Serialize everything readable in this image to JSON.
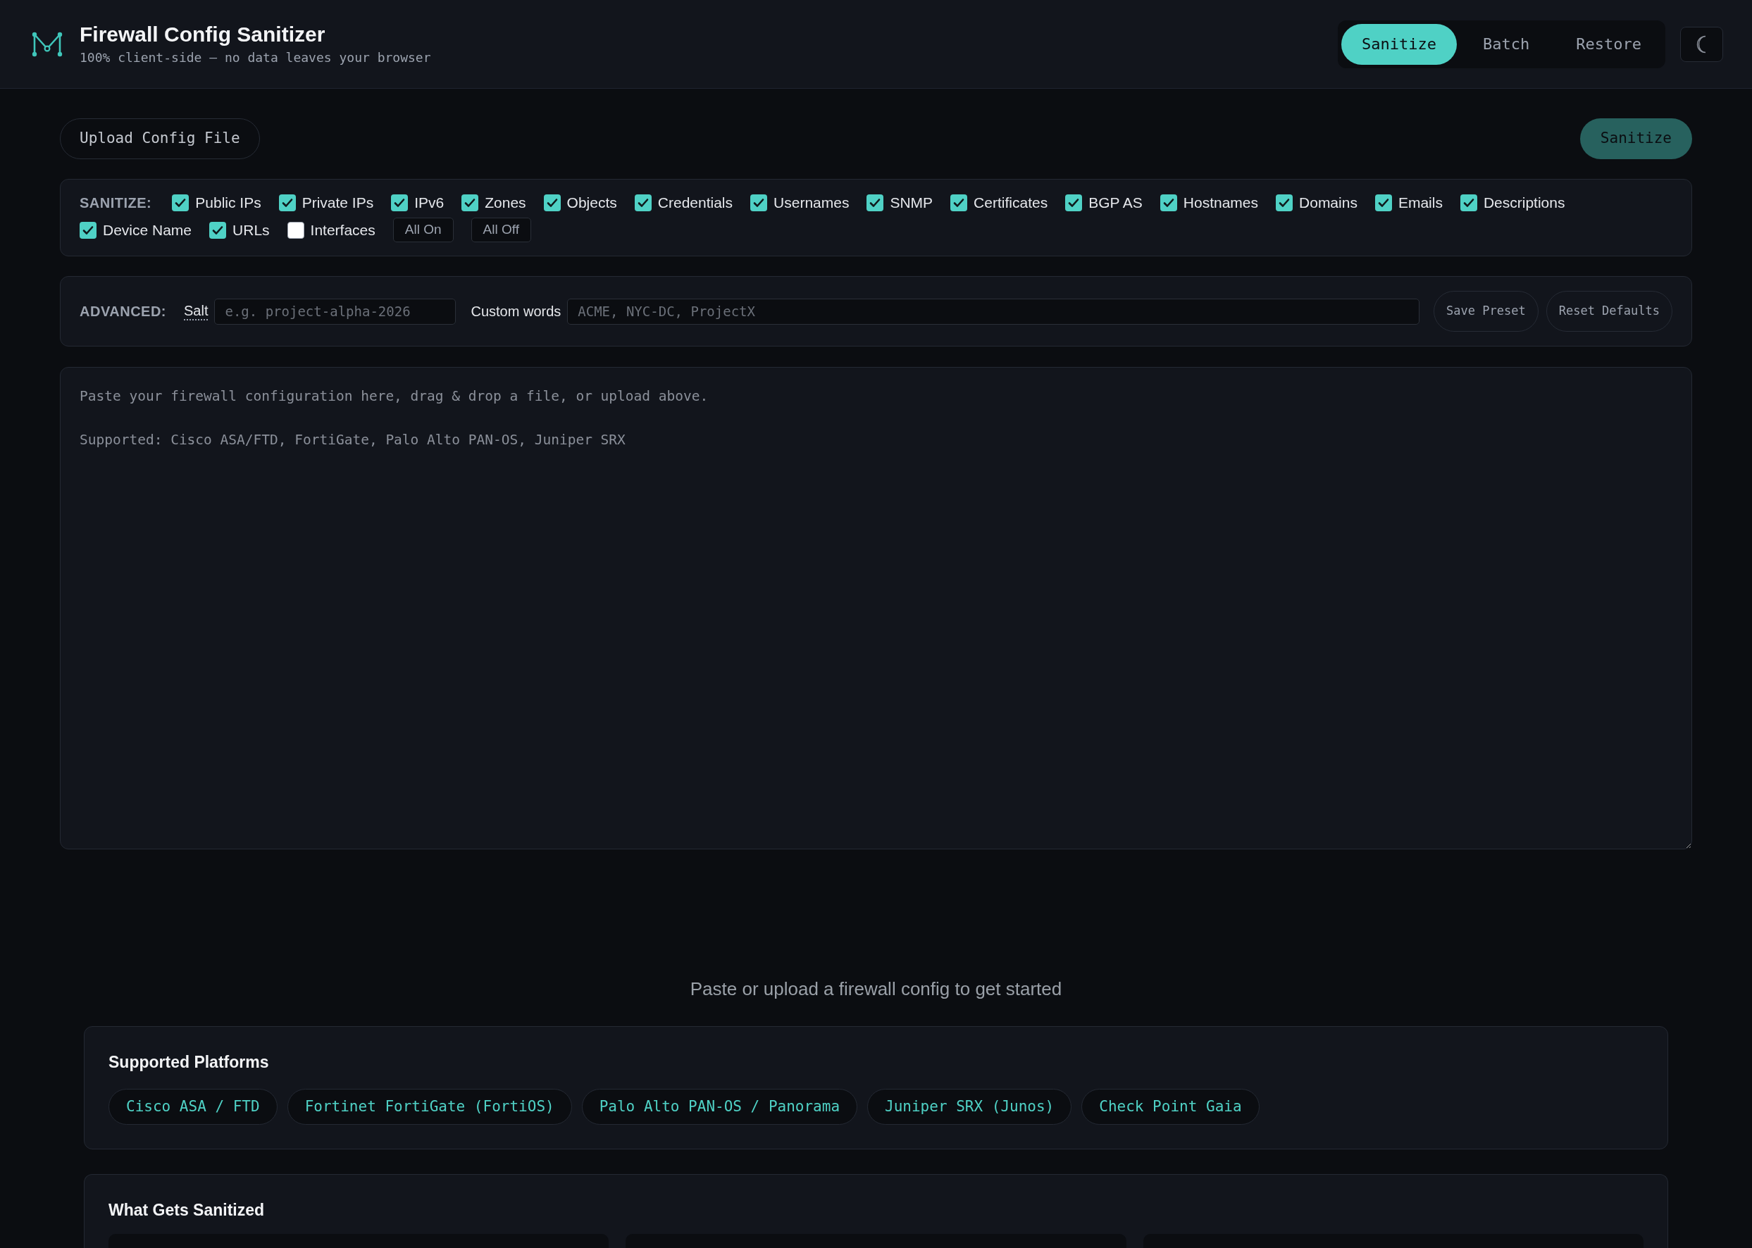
{
  "header": {
    "title": "Firewall Config Sanitizer",
    "subtitle": "100% client-side — no data leaves your browser"
  },
  "tabs": [
    {
      "label": "Sanitize",
      "selected": true
    },
    {
      "label": "Batch",
      "selected": false
    },
    {
      "label": "Restore",
      "selected": false
    }
  ],
  "toolbar": {
    "upload_button": "Upload Config File",
    "sanitize_button": {
      "label": "Sanitize",
      "disabled": true
    }
  },
  "sanitize_options": {
    "label": "SANITIZE:",
    "options": [
      {
        "label": "Public IPs",
        "checked": true
      },
      {
        "label": "Private IPs",
        "checked": true
      },
      {
        "label": "IPv6",
        "checked": true
      },
      {
        "label": "Zones",
        "checked": true
      },
      {
        "label": "Objects",
        "checked": true
      },
      {
        "label": "Credentials",
        "checked": true
      },
      {
        "label": "Usernames",
        "checked": true
      },
      {
        "label": "SNMP",
        "checked": true
      },
      {
        "label": "Certificates",
        "checked": true
      },
      {
        "label": "BGP AS",
        "checked": true
      },
      {
        "label": "Hostnames",
        "checked": true
      },
      {
        "label": "Domains",
        "checked": true
      },
      {
        "label": "Emails",
        "checked": true
      },
      {
        "label": "Descriptions",
        "checked": true
      },
      {
        "label": "Device Name",
        "checked": true
      },
      {
        "label": "URLs",
        "checked": true
      },
      {
        "label": "Interfaces",
        "checked": false
      }
    ],
    "buttons": [
      "All On",
      "All Off"
    ]
  },
  "advanced": {
    "label": "ADVANCED:",
    "salt": {
      "label": "Salt",
      "placeholder": "e.g. project-alpha-2026"
    },
    "custom_words": {
      "label": "Custom words",
      "placeholder": "ACME, NYC-DC, ProjectX"
    },
    "buttons": [
      "Save Preset",
      "Reset Defaults"
    ]
  },
  "config_input": {
    "placeholder": "Paste your firewall configuration here, drag & drop a file, or upload above.\n\nSupported: Cisco ASA/FTD, FortiGate, Palo Alto PAN-OS, Juniper SRX"
  },
  "empty_state": "Paste or upload a firewall config to get started",
  "supported_platforms": {
    "title": "Supported Platforms",
    "platforms": [
      "Cisco ASA / FTD",
      "Fortinet FortiGate (FortiOS)",
      "Palo Alto PAN-OS / Panorama",
      "Juniper SRX (Junos)",
      "Check Point Gaia"
    ]
  },
  "what_gets_sanitized": {
    "title": "What Gets Sanitized"
  }
}
